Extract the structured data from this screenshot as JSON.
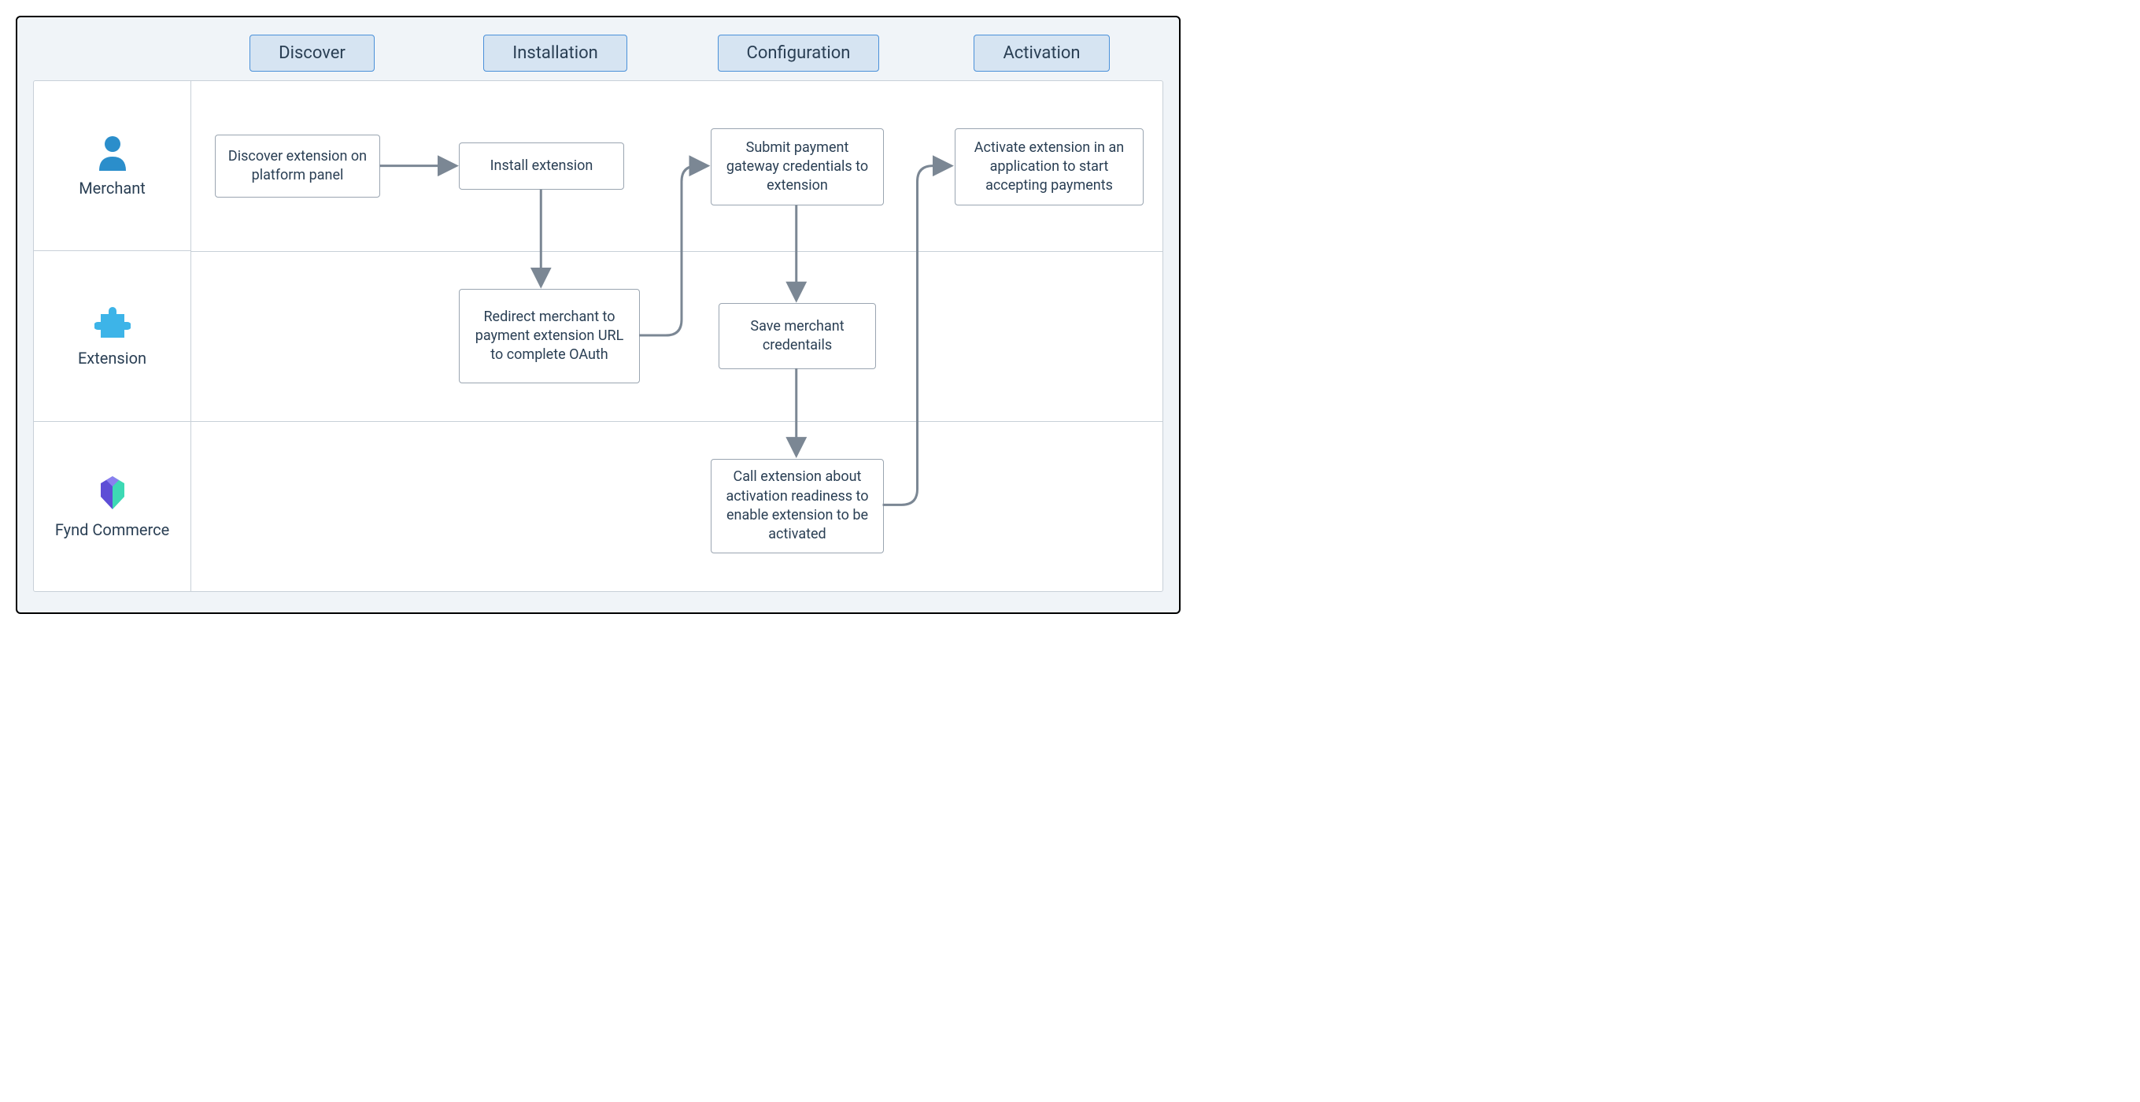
{
  "phases": [
    "Discover",
    "Installation",
    "Configuration",
    "Activation"
  ],
  "lanes": {
    "merchant": "Merchant",
    "extension": "Extension",
    "fynd": "Fynd Commerce"
  },
  "nodes": {
    "discover": "Discover extension on platform panel",
    "install": "Install extension",
    "redirect": "Redirect merchant to payment extension URL to complete OAuth",
    "submit": "Submit payment gateway credentials to extension",
    "save": "Save merchant credentails",
    "call": "Call extension about activation readiness to enable extension to be activated",
    "activate": "Activate extension in an application to start accepting payments"
  },
  "colors": {
    "phaseFill": "#d6e4f2",
    "phaseBorder": "#4a90d9",
    "nodeBorder": "#9aa5b1",
    "gridBorder": "#c8d0d8",
    "arrow": "#7b8794",
    "iconBlue": "#2b8ecb",
    "fyndPurple": "#5d4ed6",
    "fyndTeal": "#3dd9b4"
  }
}
